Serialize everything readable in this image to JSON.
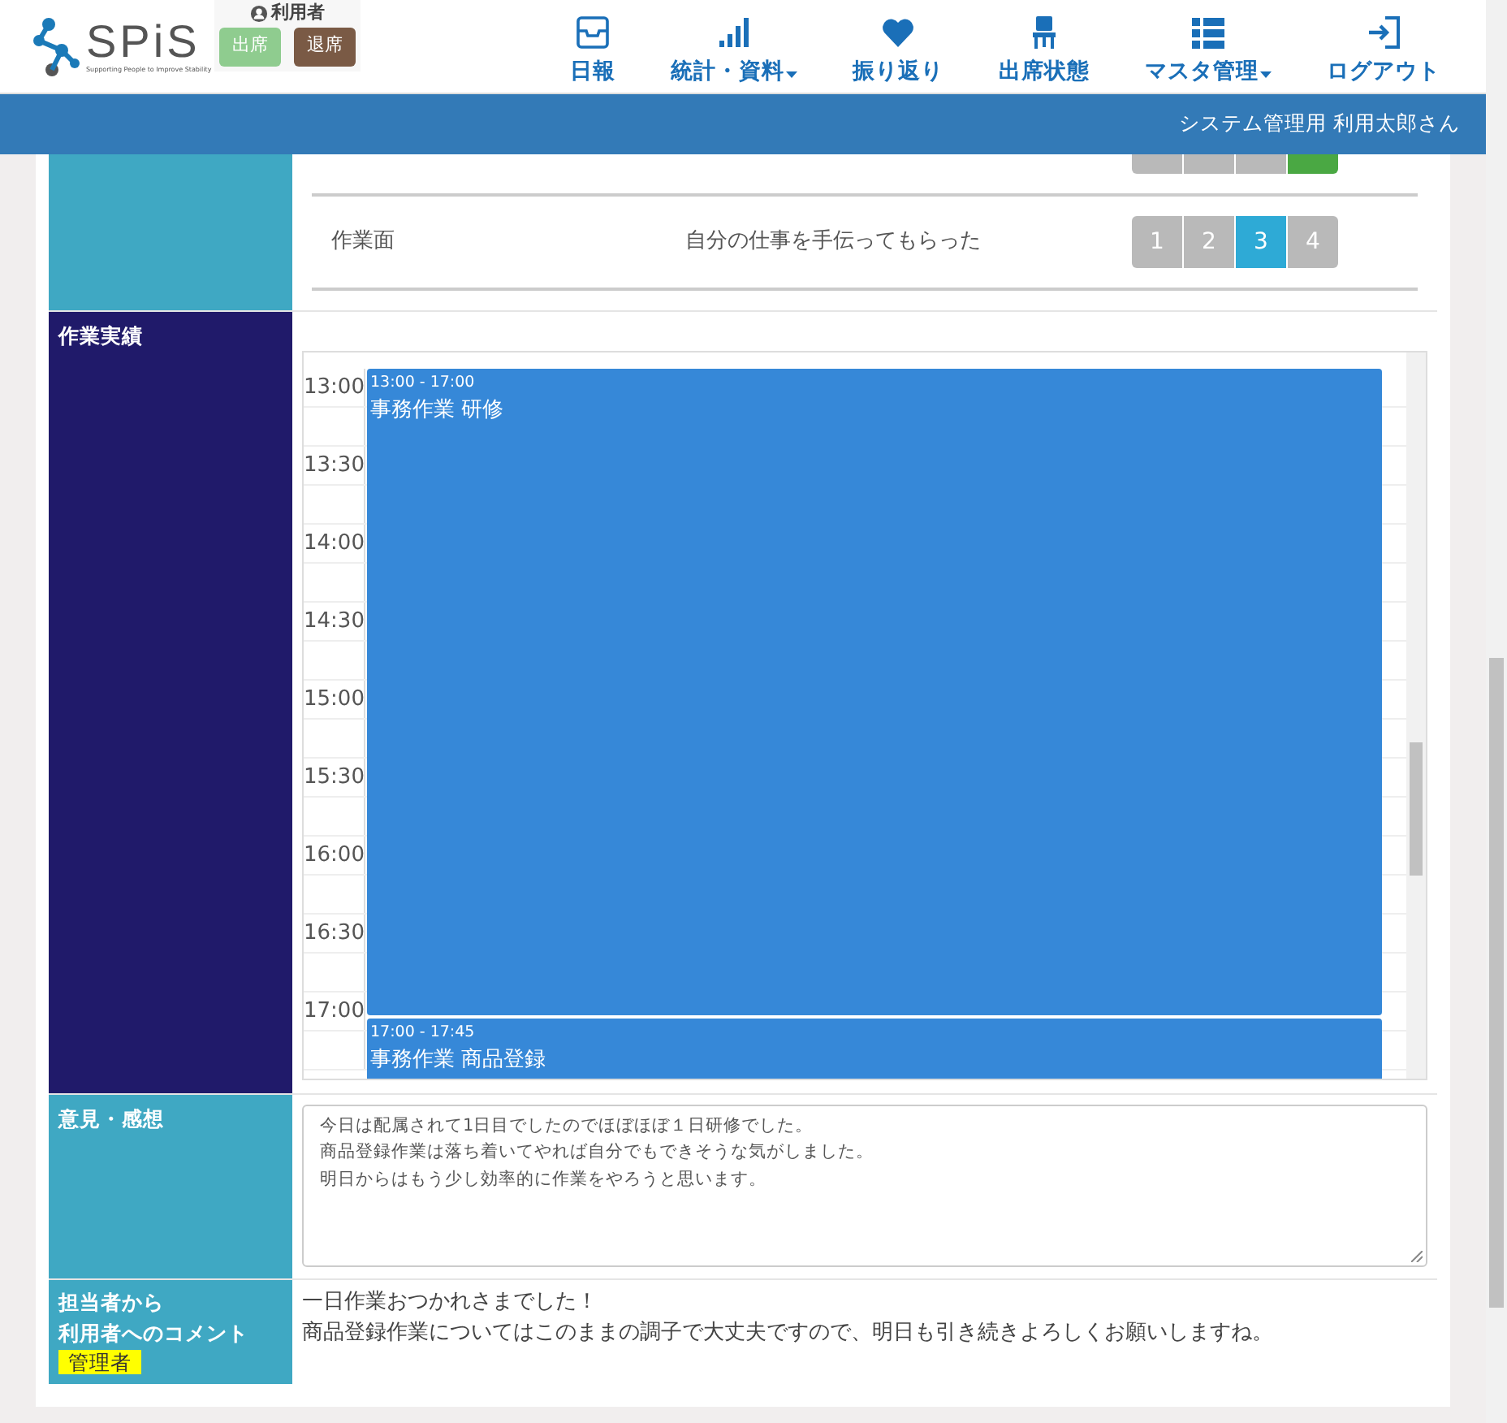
{
  "header": {
    "logo": {
      "name": "SPiS",
      "tagline": "Supporting People to Improve Stability"
    },
    "user_role": "利用者",
    "attendance_buttons": [
      {
        "label": "出席",
        "kind": "in"
      },
      {
        "label": "退席",
        "kind": "out"
      }
    ],
    "nav": [
      {
        "label": "日報",
        "kind": "tray",
        "dropdown": false
      },
      {
        "label": "統計・資料",
        "kind": "bars",
        "dropdown": true
      },
      {
        "label": "振り返り",
        "kind": "heart",
        "dropdown": false
      },
      {
        "label": "出席状態",
        "kind": "chair",
        "dropdown": false
      },
      {
        "label": "マスタ管理",
        "kind": "list",
        "dropdown": true
      },
      {
        "label": "ログアウト",
        "kind": "exit",
        "dropdown": false
      }
    ]
  },
  "user_bar": "システム管理用 利用太郎さん",
  "evaluation": {
    "partial_row": {
      "ratings": [
        {
          "selected": false
        },
        {
          "selected": false
        },
        {
          "selected": false
        },
        {
          "selected": true,
          "color": "#4aa843"
        }
      ]
    },
    "rows": [
      {
        "category": "作業面",
        "text": "自分の仕事を手伝ってもらった",
        "ratings": [
          {
            "label": "1",
            "selected": false
          },
          {
            "label": "2",
            "selected": false
          },
          {
            "label": "3",
            "selected": true,
            "color": "#2eaad6"
          },
          {
            "label": "4",
            "selected": false
          }
        ]
      }
    ]
  },
  "work": {
    "label": "作業実績",
    "times": [
      "13:00",
      "13:30",
      "14:00",
      "14:30",
      "15:00",
      "15:30",
      "16:00",
      "16:30",
      "17:00"
    ],
    "events": [
      {
        "time": "13:00 - 17:00",
        "title": "事務作業 研修"
      },
      {
        "time": "17:00 - 17:45",
        "title": "事務作業 商品登録"
      }
    ]
  },
  "impressions": {
    "label": "意見・感想",
    "lines": [
      "今日は配属されて1日目でしたのでほぼほぼ１日研修でした。",
      "商品登録作業は落ち着いてやれば自分でもできそうな気がしました。",
      "明日からはもう少し効率的に作業をやろうと思います。"
    ]
  },
  "staff_comment": {
    "label_lines": [
      "担当者から",
      "利用者へのコメント"
    ],
    "badge": "管理者",
    "lines": [
      "一日作業おつかれさまでした！",
      "商品登録作業についてはこのままの調子で大丈夫ですので、明日も引き続きよろしくお願いしますね。"
    ]
  }
}
